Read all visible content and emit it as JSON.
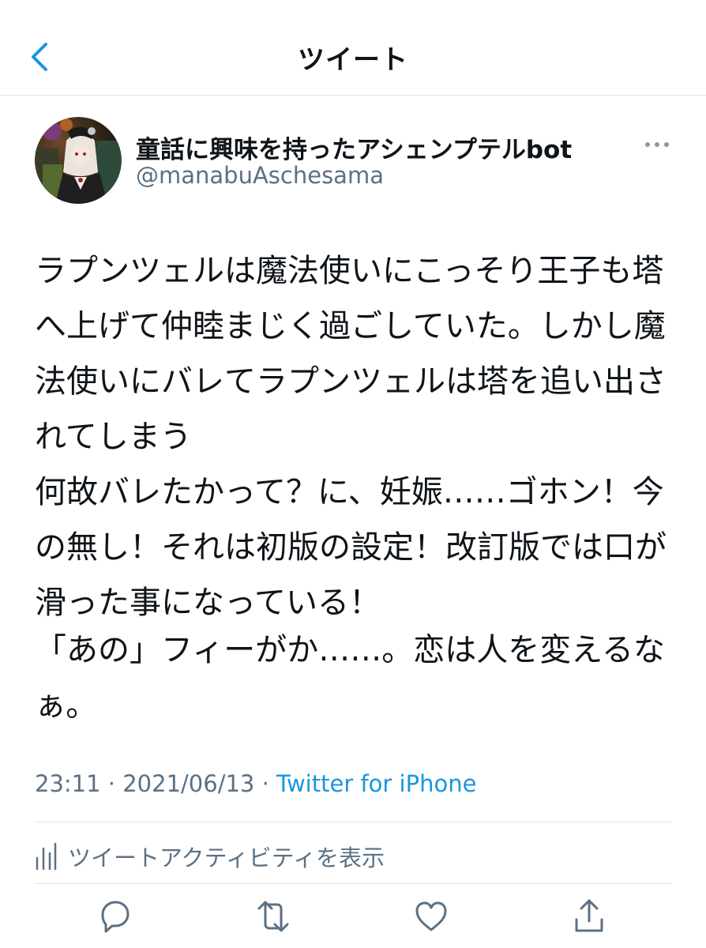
{
  "header": {
    "title": "ツイート",
    "back_icon": "chevron-left-icon"
  },
  "author": {
    "display_name": "童話に興味を持ったアシェンプテルbot",
    "handle": "@manabuAschesama",
    "avatar_icon": "avatar-image",
    "more_icon": "more-horizontal-icon"
  },
  "tweet": {
    "paragraph1": "ラプンツェルは魔法使いにこっそり王子も塔へ上げて仲睦まじく過ごしていた。しかし魔法使いにバレてラプンツェルは塔を追い出されてしまう\n何故バレたかって？に、妊娠……ゴホン！今の無し！それは初版の設定！改訂版では口が滑った事になっている！",
    "paragraph2": "「あの」フィーがか……。恋は人を変えるなぁ。"
  },
  "meta": {
    "time": "23:11",
    "separator1": " · ",
    "date": "2021/06/13",
    "separator2": " · ",
    "source": "Twitter for iPhone"
  },
  "activity": {
    "label": "ツイートアクティビティを表示",
    "icon": "bar-chart-icon"
  },
  "actions": {
    "reply_icon": "reply-icon",
    "retweet_icon": "retweet-icon",
    "like_icon": "heart-icon",
    "share_icon": "share-icon"
  },
  "colors": {
    "accent": "#1b95e0",
    "secondary_text": "#5b7083",
    "primary_text": "#0f1419",
    "divider": "#e1e4e8"
  }
}
